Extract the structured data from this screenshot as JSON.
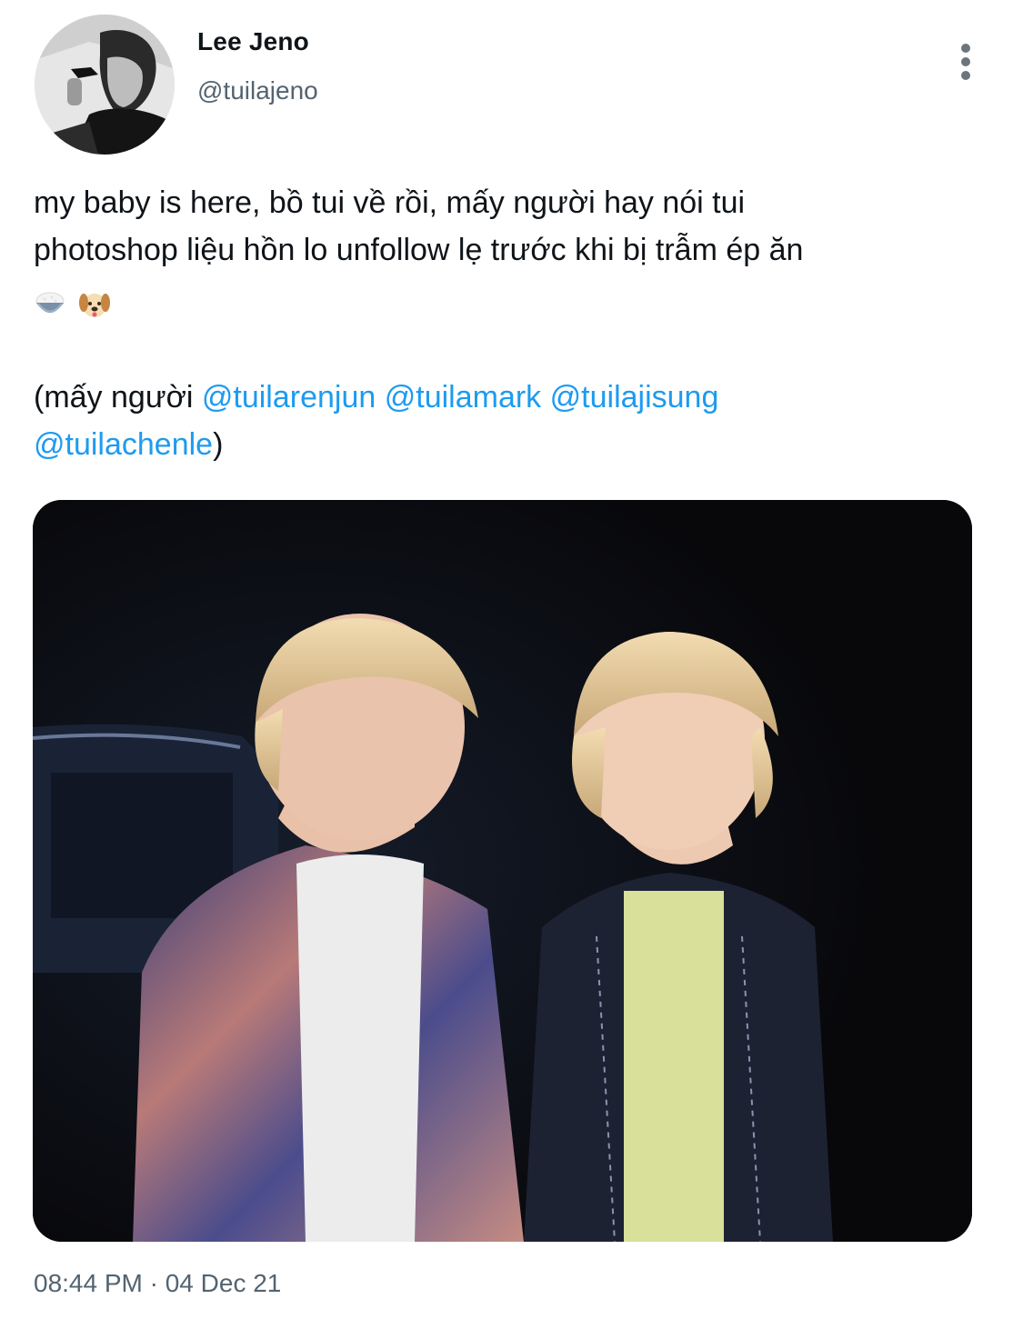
{
  "author": {
    "display_name": "Lee Jeno",
    "handle": "@tuilajeno",
    "avatar_icon": "profile-avatar"
  },
  "menu": {
    "icon": "more-vertical-icon"
  },
  "tweet": {
    "lines": [
      "my baby is here, bồ tui về rồi, mấy người hay nói tui",
      "photoshop liệu hồn lo unfollow lẹ trước khi bị trẫm ép ăn"
    ],
    "emojis": [
      "rice-bowl-icon",
      "dog-face-icon"
    ],
    "mention_prefix": "(mấy người ",
    "mentions": [
      "@tuilarenjun",
      "@tuilamark",
      "@tuilajisung",
      "@tuilachenle"
    ],
    "mention_suffix": ")"
  },
  "timestamp": "08:44 PM · 04 Dec 21",
  "colors": {
    "link": "#1d9bf0",
    "secondary_text": "#536471",
    "primary_text": "#0f1419"
  }
}
